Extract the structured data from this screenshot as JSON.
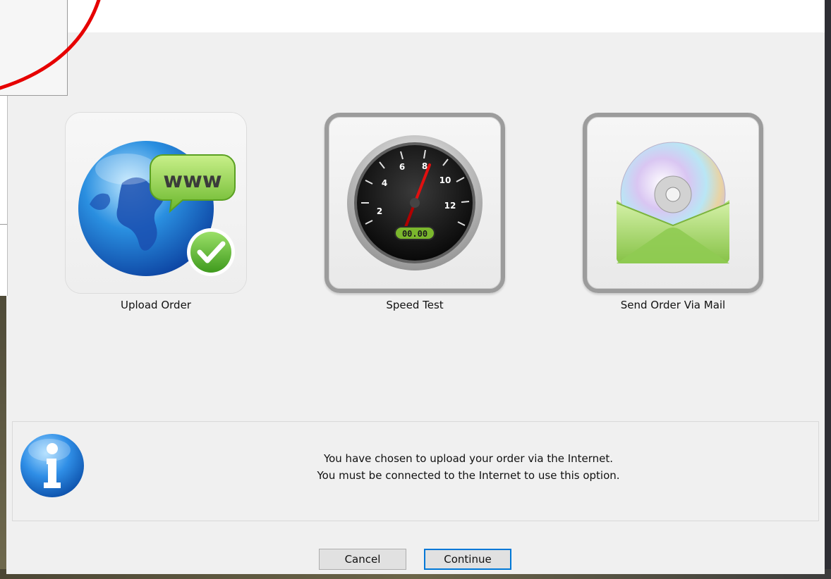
{
  "options": [
    {
      "label": "Upload Order",
      "icon": "globe-www-check-icon",
      "selected": true
    },
    {
      "label": "Speed Test",
      "icon": "speedometer-icon",
      "selected": false
    },
    {
      "label": "Send Order Via Mail",
      "icon": "cd-envelope-icon",
      "selected": false
    }
  ],
  "speedometer": {
    "ticks": [
      "2",
      "4",
      "6",
      "8",
      "10",
      "12"
    ],
    "readout": "00.00"
  },
  "upload_icon": {
    "bubble_text": "www"
  },
  "info": {
    "icon": "info-icon",
    "line1": "You have chosen to upload your order via the Internet.",
    "line2": "You must be connected to the Internet to use this option."
  },
  "buttons": {
    "cancel": "Cancel",
    "continue": "Continue"
  },
  "colors": {
    "accent": "#0078d7",
    "annotation": "#e60000",
    "dialog_bg": "#f0f0f0"
  }
}
